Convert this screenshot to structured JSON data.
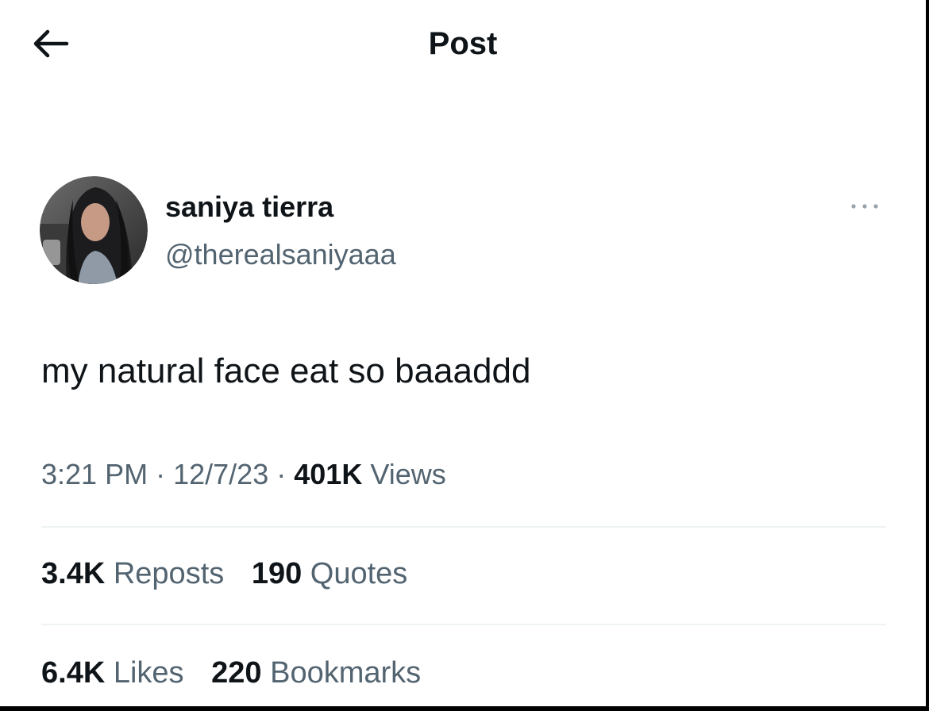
{
  "header": {
    "title": "Post",
    "back_icon": "arrow-left-icon"
  },
  "author": {
    "name": "saniya tierra",
    "handle": "@therealsaniyaaa",
    "more_icon": "more-horizontal-icon"
  },
  "post": {
    "text": "my natural face eat so baaaddd"
  },
  "meta": {
    "time": "3:21 PM",
    "separator": "·",
    "date": "12/7/23",
    "views_count": "401K",
    "views_label": "Views"
  },
  "engagement": {
    "reposts_count": "3.4K",
    "reposts_label": "Reposts",
    "quotes_count": "190",
    "quotes_label": "Quotes",
    "likes_count": "6.4K",
    "likes_label": "Likes",
    "bookmarks_count": "220",
    "bookmarks_label": "Bookmarks"
  },
  "colors": {
    "text_primary": "#0f1419",
    "text_secondary": "#536471",
    "divider": "#eff3f4",
    "background": "#ffffff"
  }
}
